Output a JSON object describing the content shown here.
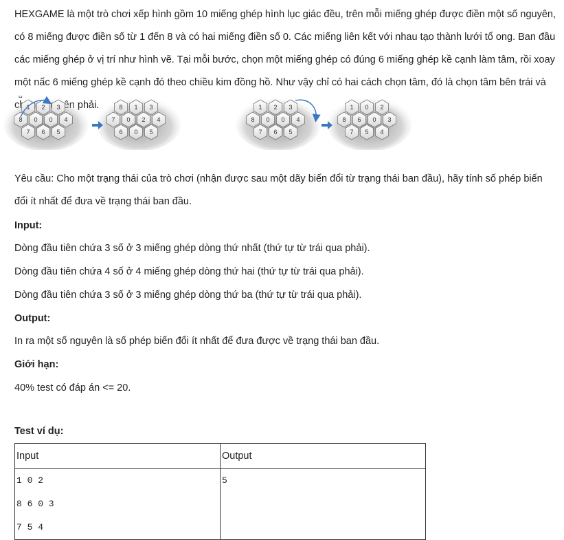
{
  "intro": "HEXGAME là một trò chơi xếp hình gồm 10 miếng ghép hình lục giác đều, trên mỗi miếng ghép được điền một số nguyên, có 8 miếng được điền số  từ 1 đến 8 và có hai miếng điền số 0. Các miếng liên kết với nhau tạo thành lưới tổ ong. Ban đầu các miếng ghép ở vị trí như hình vẽ. Tại mỗi bước, chọn một miếng ghép có đúng 6 miếng ghép kề cạnh làm tâm, rồi xoay một nấc 6 miếng ghép kề cạnh đó theo chiều kim đồng hồ. Như vậy chỉ có hai cách chọn tâm, đó là chọn tâm bên trái và chọn tâm bên phải.",
  "figure": {
    "caption_glyph": "␣",
    "boards": [
      [
        [
          "1",
          "2",
          "3"
        ],
        [
          "8",
          "0",
          "0",
          "4"
        ],
        [
          "7",
          "6",
          "5"
        ]
      ],
      [
        [
          "8",
          "1",
          "3"
        ],
        [
          "7",
          "0",
          "2",
          "4"
        ],
        [
          "6",
          "0",
          "5"
        ]
      ],
      [
        [
          "1",
          "2",
          "3"
        ],
        [
          "8",
          "0",
          "0",
          "4"
        ],
        [
          "7",
          "6",
          "5"
        ]
      ],
      [
        [
          "1",
          "0",
          "2"
        ],
        [
          "8",
          "6",
          "0",
          "3"
        ],
        [
          "7",
          "5",
          "4"
        ]
      ]
    ]
  },
  "requirement": "Yêu cầu: Cho một trạng thái của trò chơi (nhận được sau một dãy biến đổi từ trạng thái ban đầu), hãy tính số phép biến đổi ít nhất để đưa về trạng thái ban đầu.",
  "input_heading": "Input:",
  "input_lines": [
    "Dòng đầu tiên chứa 3 số ở 3 miếng ghép dòng thứ nhất (thứ tự từ trái qua phải).",
    "Dòng đầu tiên chứa 4 số ở 4 miếng ghép dòng thứ hai (thứ tự từ trái qua phải).",
    "Dòng đầu tiên chứa 3 số ở 3 miếng ghép dòng thứ ba (thứ tự từ trái qua phải)."
  ],
  "output_heading": "Output:",
  "output_line": "In ra một số nguyên là số phép biến đổi ít nhất để đưa được về trạng thái ban đầu.",
  "limits_heading": "Giới hạn:",
  "limits_line": "40% test có đáp án <= 20.",
  "sample_heading": "Test ví dụ:",
  "sample": {
    "header_input": "Input",
    "header_output": "Output",
    "input_rows": [
      "1  0  2",
      "8  6  0  3",
      "7  5  4"
    ],
    "output": "5"
  }
}
